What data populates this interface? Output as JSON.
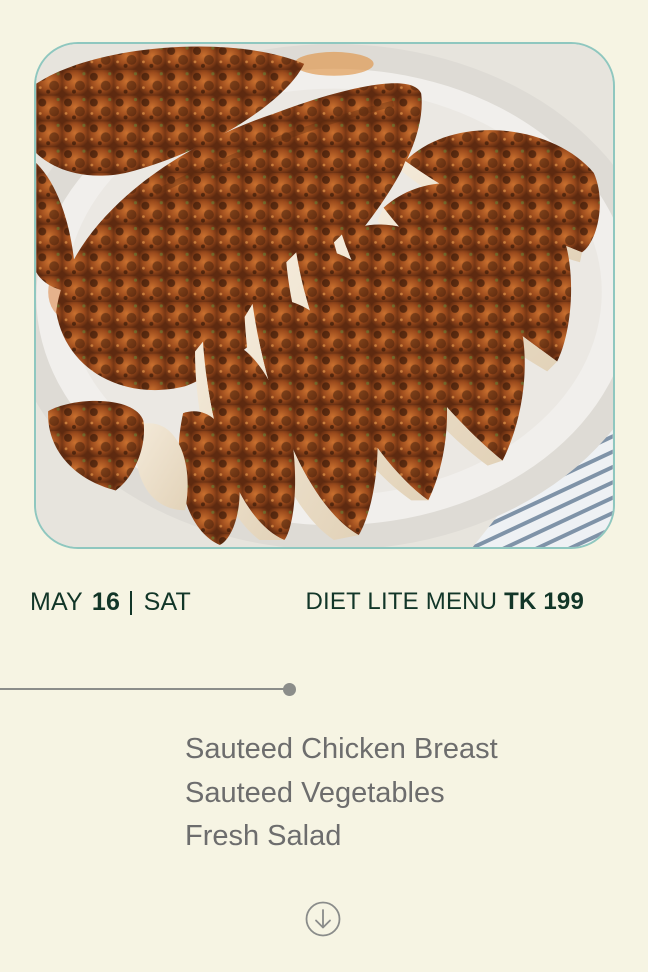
{
  "hero": {
    "icon": "grilled-chicken-photo"
  },
  "date": {
    "month": "MAY",
    "day": "16",
    "weekday": "SAT"
  },
  "menu": {
    "title": "DIET LITE MENU",
    "price": "TK 199"
  },
  "items": [
    "Sauteed Chicken Breast",
    "Sauteed Vegetables",
    "Fresh Salad"
  ],
  "scroll": {
    "icon": "arrow-down-circle-icon"
  },
  "colors": {
    "background": "#f6f4e3",
    "text_dark": "#123628",
    "text_muted": "#6d6d6d",
    "frame_border": "#8fc7bf",
    "divider": "#8b8d8a"
  }
}
